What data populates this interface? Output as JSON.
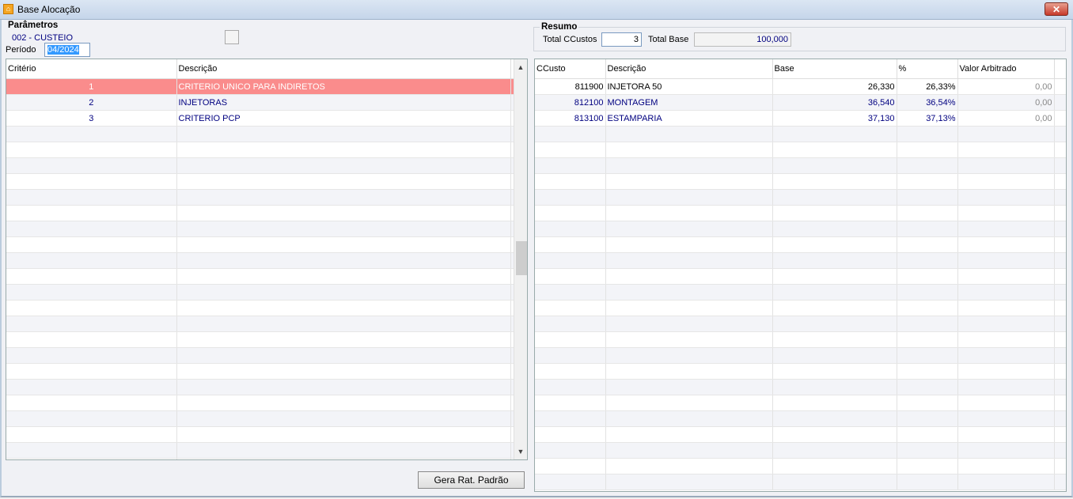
{
  "window": {
    "title": "Base Alocação",
    "close_label": "✕"
  },
  "params": {
    "group_label": "Parâmetros",
    "custeio": "002 - CUSTEIO",
    "periodo_label": "Período",
    "periodo_value": "04/2024"
  },
  "left_grid": {
    "columns": [
      "Critério",
      "Descrição"
    ],
    "rows": [
      {
        "criterio": "1",
        "descricao": "CRITERIO UNICO PARA INDIRETOS"
      },
      {
        "criterio": "2",
        "descricao": "INJETORAS"
      },
      {
        "criterio": "3",
        "descricao": "CRITERIO PCP"
      }
    ],
    "scroll_up": "▲",
    "scroll_down": "▼"
  },
  "resumo": {
    "group_label": "Resumo",
    "total_ccustos_label": "Total CCustos",
    "total_ccustos_value": "3",
    "total_base_label": "Total Base",
    "total_base_value": "100,000"
  },
  "right_grid": {
    "columns": [
      "CCusto",
      "Descrição",
      "Base",
      "%",
      "Valor Arbitrado"
    ],
    "rows": [
      {
        "ccusto": "811900",
        "descricao": "INJETORA 50",
        "base": "26,330",
        "pct": "26,33%",
        "valor": "0,00"
      },
      {
        "ccusto": "812100",
        "descricao": "MONTAGEM",
        "base": "36,540",
        "pct": "36,54%",
        "valor": "0,00"
      },
      {
        "ccusto": "813100",
        "descricao": "ESTAMPARIA",
        "base": "37,130",
        "pct": "37,13%",
        "valor": "0,00"
      }
    ]
  },
  "buttons": {
    "gera_rat": "Gera Rat. Padrão"
  },
  "colors": {
    "selected_row": "#fa8c8c",
    "data_text": "#000080"
  }
}
